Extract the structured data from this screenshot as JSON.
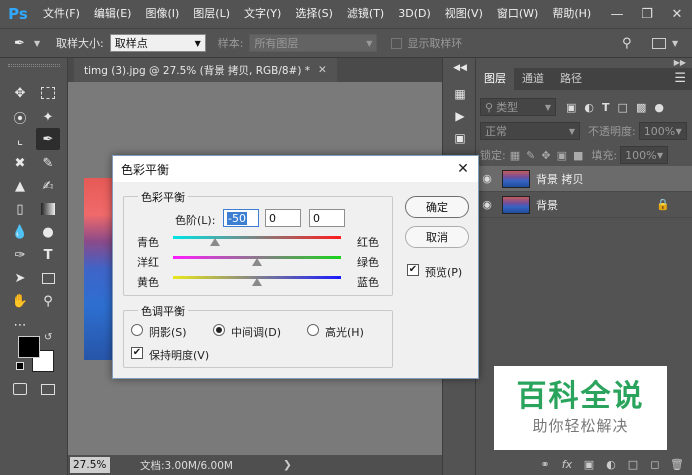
{
  "app": {
    "logo": "Ps"
  },
  "menu": [
    "文件(F)",
    "编辑(E)",
    "图像(I)",
    "图层(L)",
    "文字(Y)",
    "选择(S)",
    "滤镜(T)",
    "3D(D)",
    "视图(V)",
    "窗口(W)",
    "帮助(H)"
  ],
  "options_bar": {
    "sample_size_label": "取样大小:",
    "sample_size_value": "取样点",
    "sample_label": "样本:",
    "sample_value": "所有图层",
    "show_ring_label": "显示取样环"
  },
  "document": {
    "tab_title": "timg (3).jpg @ 27.5% (背景 拷贝, RGB/8#) *",
    "zoom": "27.5%",
    "doc_info": "文档:3.00M/6.00M"
  },
  "layers_panel": {
    "tabs": [
      "图层",
      "通道",
      "路径"
    ],
    "filter_label": "类型",
    "blend_mode": "正常",
    "opacity_label": "不透明度:",
    "opacity_value": "100%",
    "lock_label": "锁定:",
    "fill_label": "填充:",
    "fill_value": "100%",
    "layers": [
      {
        "name": "背景 拷贝",
        "selected": true,
        "locked": false
      },
      {
        "name": "背景",
        "selected": false,
        "locked": true
      }
    ]
  },
  "watermark": {
    "title": "百科全说",
    "subtitle": "助你轻松解决"
  },
  "dialog": {
    "title": "色彩平衡",
    "color_balance_group": "色彩平衡",
    "levels_label": "色阶(L):",
    "levels": [
      "-50",
      "0",
      "0"
    ],
    "sliders": [
      {
        "left": "青色",
        "right": "红色",
        "value": -50
      },
      {
        "left": "洋红",
        "right": "绿色",
        "value": 0
      },
      {
        "left": "黄色",
        "right": "蓝色",
        "value": 0
      }
    ],
    "tone_group": "色调平衡",
    "tones": [
      {
        "label": "阴影(S)",
        "checked": false
      },
      {
        "label": "中间调(D)",
        "checked": true
      },
      {
        "label": "高光(H)",
        "checked": false
      }
    ],
    "preserve_luminosity": "保持明度(V)",
    "preserve_checked": true,
    "ok": "确定",
    "cancel": "取消",
    "preview": "预览(P)",
    "preview_checked": true
  },
  "colors": {
    "accent_blue": "#31a8ff",
    "watermark_green": "#2aa45c"
  }
}
